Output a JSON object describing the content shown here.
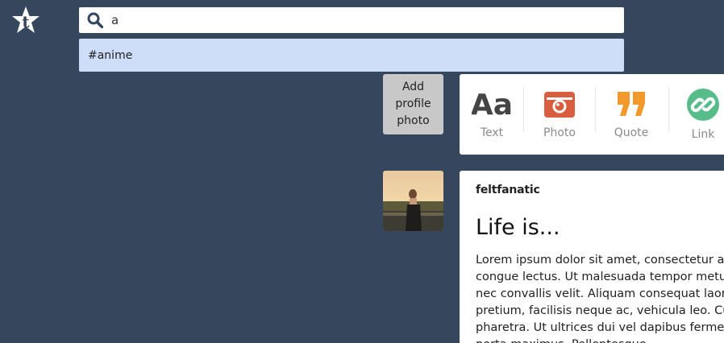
{
  "header": {
    "logo_icon": "tumblr-star-logo",
    "search": {
      "value": "a",
      "placeholder": "",
      "icon": "search-icon"
    },
    "suggestions": [
      {
        "label": "#anime"
      }
    ]
  },
  "composer": {
    "add_photo_label": "Add profile photo",
    "post_types": [
      {
        "label": "Text",
        "icon": "text-aa-icon",
        "color": "#444444"
      },
      {
        "label": "Photo",
        "icon": "camera-icon",
        "color": "#d95e40"
      },
      {
        "label": "Quote",
        "icon": "quote-icon",
        "color": "#f2992e"
      },
      {
        "label": "Link",
        "icon": "link-icon",
        "color": "#56bc8a"
      }
    ]
  },
  "feed": {
    "posts": [
      {
        "author": "feltfanatic",
        "title": "Life is...",
        "body_lines": [
          "Lorem ipsum dolor sit amet, consectetur adip",
          "congue lectus. Ut malesuada tempor metus v",
          "nec convallis velit. Aliquam consequat laoree",
          "pretium, facilisis neque ac, vehicula leo. Cura",
          "pharetra. Ut ultrices dui vel dapibus ferment",
          "porta maximus. Pellentesque"
        ]
      }
    ]
  },
  "colors": {
    "background": "#36465d",
    "suggestion_highlight": "#cfdef8"
  }
}
